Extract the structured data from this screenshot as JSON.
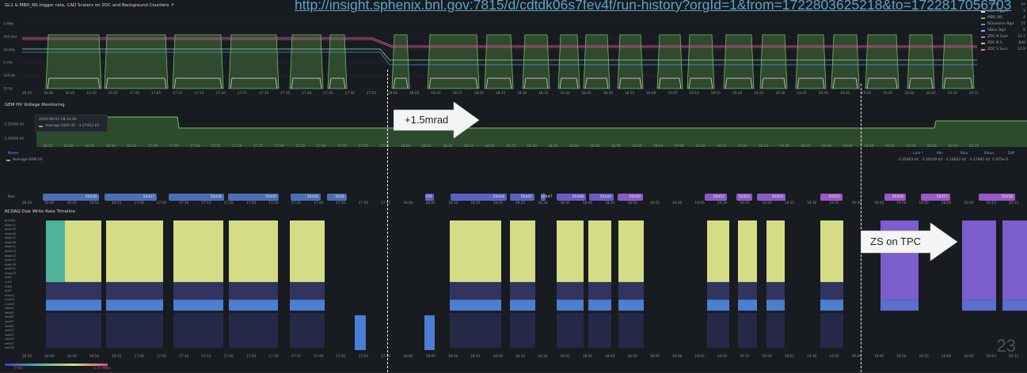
{
  "url": "http://insight.sphenix.bnl.gov:7815/d/cdtdk06s7fev4f/run-history?orgId=1&from=1722803625218&to=1722817056703",
  "panels": {
    "trigger": {
      "title": "GL1 & MBD_NS trigger rate, CAD Scalers on ZDC and Background Counters",
      "y_ticks": [
        "1 MHz",
        "100 kHz",
        "10 kHz",
        "1 kHz",
        "100 Hz",
        "10 Hz"
      ],
      "legend": {
        "col_name": "Name",
        "col_last": "La",
        "items": [
          {
            "name": "GL1 Trigger",
            "value": "2",
            "color": "#f0f0f0"
          },
          {
            "name": "MBD_NS",
            "value": "4",
            "color": "#73bf69"
          },
          {
            "name": "NQuelsion Bgd",
            "value": "57",
            "color": "#5794f2"
          },
          {
            "name": "SBlue Bgd",
            "value": "6",
            "color": "#8ab8ff"
          },
          {
            "name": "ZDC N Sum",
            "value": "12.7",
            "color": "#b877d9"
          },
          {
            "name": "ZDC N S",
            "value": "840",
            "color": "#96d98d"
          },
          {
            "name": "ZDC S Sum",
            "value": "12.9",
            "color": "#ff7383"
          }
        ]
      }
    },
    "gem": {
      "title": "GEM HV Voltage Monitoring",
      "y_ticks": [
        "-3.25000 kV",
        "-3.30000 kV"
      ],
      "tooltip_time": "2024-08-04 18:34:00",
      "tooltip_series": "Average GEM HV",
      "tooltip_value": "-3.27452 kV",
      "legend_name": "Name",
      "legend_series": "Average GEM HV",
      "stats_headers": [
        "Last *",
        "Min",
        "Max",
        "Mean",
        "Diff"
      ],
      "stats_values": [
        "-3.35403 kV",
        "-3.35039 kV",
        "-3.24832 kV",
        "-3.27682 kV",
        "2.455e-5"
      ]
    },
    "runs": {
      "label": "Run",
      "pills": [
        {
          "num": "50436",
          "color": "#4a6fb6"
        },
        {
          "num": "50437",
          "color": "#4a6fb6"
        },
        {
          "num": "50438",
          "color": "#4a6fb6"
        },
        {
          "num": "50439",
          "color": "#4a6fb6"
        },
        {
          "num": "50440",
          "color": "#4a6fb6"
        },
        {
          "num": "5044",
          "color": "#4a6fb6"
        },
        {
          "num": "504",
          "color": "#5b62c4"
        },
        {
          "num": "50444",
          "color": "#5b62c4"
        },
        {
          "num": "50445",
          "color": "#5b62c4"
        },
        {
          "num": "50447",
          "color": "#5b62c4"
        },
        {
          "num": "50448",
          "color": "#6a5bc6"
        },
        {
          "num": "50449",
          "color": "#6a5bc6"
        },
        {
          "num": "50450",
          "color": "#8a5bc6"
        },
        {
          "num": "50451",
          "color": "#8a5bc6"
        },
        {
          "num": "50452",
          "color": "#8a5bc6"
        },
        {
          "num": "50454",
          "color": "#8a5bc6"
        },
        {
          "num": "50455",
          "color": "#9b58c6"
        },
        {
          "num": "50456",
          "color": "#9b58c6"
        },
        {
          "num": "50457",
          "color": "#9b58c6"
        },
        {
          "num": "50458",
          "color": "#9b58c6"
        }
      ]
    },
    "disk": {
      "title": "RCDAQ Disk Write Rate Timeline",
      "rows": [
        "gl1daq",
        "ebdc00",
        "ebdc01",
        "ebdc02",
        "ebdc03",
        "ebdc04",
        "ebdc05",
        "ebdc06",
        "ebdc07",
        "ebdc08",
        "ebdc09",
        "ebdc10",
        "ebdc11",
        "ebdc12",
        "ebdc13",
        "ebdc14",
        "ebdc15",
        "ebdc16",
        "ebdc17",
        "ebdc18",
        "ebdc19",
        "ebdc20",
        "ebdc21",
        "ebdc22",
        "ebdc23",
        "intt0",
        "intt1",
        "intt2",
        "intt3",
        "intt4",
        "intt5",
        "intt6",
        "intt7",
        "mvtx0",
        "mvtx1",
        "mvtx2",
        "mvtx3",
        "mvtx4",
        "mvtx5",
        "seb00",
        "seb01",
        "seb02",
        "seb03",
        "seb04",
        "seb05",
        "seb06",
        "seb07",
        "seb08",
        "seb09",
        "seb10",
        "seb11",
        "seb12",
        "seb13",
        "seb14",
        "seb15",
        "seb16",
        "seb17",
        "seb18",
        "seb19",
        "seb20"
      ],
      "colorbar_min": "0 B/s",
      "colorbar_max": "1.10 MB/s"
    }
  },
  "time_ticks": [
    "16:35",
    "16:40",
    "16:45",
    "16:50",
    "16:55",
    "17:00",
    "17:05",
    "17:10",
    "17:15",
    "17:20",
    "17:25",
    "17:30",
    "17:35",
    "17:40",
    "17:45",
    "17:50",
    "17:55",
    "18:00",
    "18:05",
    "18:10",
    "18:15",
    "18:20",
    "18:25",
    "18:30",
    "18:35",
    "18:40",
    "18:45",
    "18:50",
    "18:55",
    "19:00",
    "19:05",
    "19:10",
    "19:15",
    "19:20",
    "19:25",
    "19:30",
    "19:35",
    "19:40",
    "19:45",
    "19:50",
    "19:55",
    "20:00",
    "20:05",
    "20:10",
    "20:15"
  ],
  "annotations": {
    "crossing_angle": "+1.5mrad",
    "zs_tpc": "ZS on TPC"
  },
  "page_number": "23"
}
